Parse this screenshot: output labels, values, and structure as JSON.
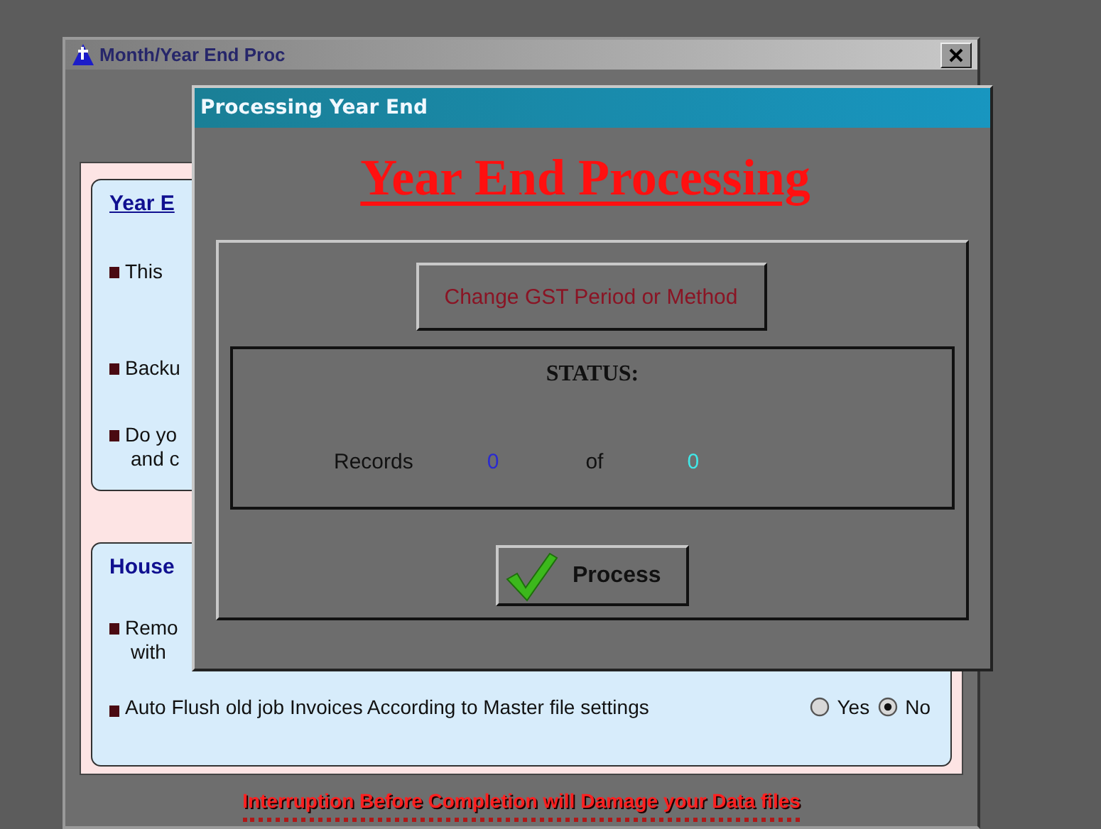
{
  "background_window": {
    "title": "Month/Year End Proc",
    "sections": [
      {
        "heading": "Year E",
        "bullets": [
          {
            "lines": [
              "This"
            ]
          },
          {
            "lines": [
              "Backu"
            ]
          },
          {
            "lines": [
              "Do yo",
              "and c"
            ]
          }
        ]
      },
      {
        "heading": "House",
        "bullets": [
          {
            "lines": [
              "Remo",
              "with"
            ]
          }
        ],
        "options": [
          {
            "label": "Auto Flush old job Invoices According to Master file settings",
            "choices": [
              {
                "label": "Yes",
                "selected": false
              },
              {
                "label": "No",
                "selected": true
              }
            ]
          }
        ]
      }
    ],
    "warning": "Interruption Before Completion will Damage your Data files"
  },
  "dialog": {
    "title": "Processing Year End",
    "heading": "Year End Processing",
    "gst_button": "Change GST Period or Method",
    "status": {
      "label": "STATUS:",
      "records_label": "Records",
      "current": "0",
      "of_label": "of",
      "total": "0"
    },
    "process_button": "Process"
  }
}
